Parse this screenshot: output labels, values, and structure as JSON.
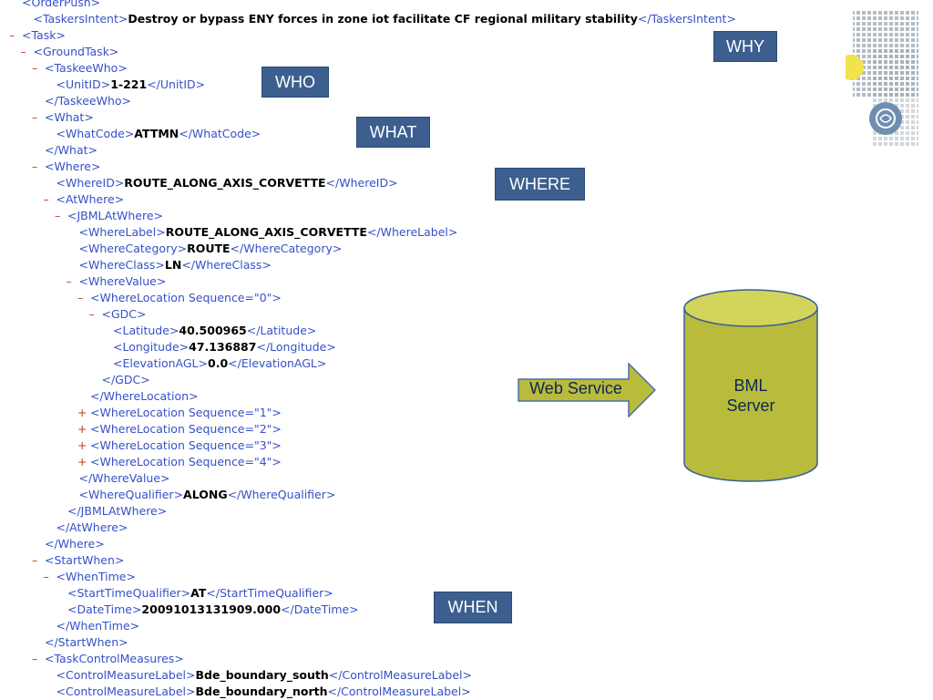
{
  "xml_lines": [
    {
      "pm": "",
      "indent": 0,
      "open": "<OrderPush>",
      "value": "",
      "close": ""
    },
    {
      "pm": "",
      "indent": 1,
      "open": "<TaskersIntent>",
      "value": "Destroy or bypass ENY forces in zone iot facilitate CF regional military stability",
      "close": "</TaskersIntent>"
    },
    {
      "pm": "–",
      "indent": 0,
      "open": "<Task>",
      "value": "",
      "close": ""
    },
    {
      "pm": "–",
      "indent": 1,
      "open": "<GroundTask>",
      "value": "",
      "close": ""
    },
    {
      "pm": "–",
      "indent": 2,
      "open": "<TaskeeWho>",
      "value": "",
      "close": ""
    },
    {
      "pm": "",
      "indent": 3,
      "open": "<UnitID>",
      "value": "1-221",
      "close": "</UnitID>"
    },
    {
      "pm": "",
      "indent": 2,
      "open": "</TaskeeWho>",
      "value": "",
      "close": ""
    },
    {
      "pm": "–",
      "indent": 2,
      "open": "<What>",
      "value": "",
      "close": ""
    },
    {
      "pm": "",
      "indent": 3,
      "open": "<WhatCode>",
      "value": "ATTMN",
      "close": "</WhatCode>"
    },
    {
      "pm": "",
      "indent": 2,
      "open": "</What>",
      "value": "",
      "close": ""
    },
    {
      "pm": "–",
      "indent": 2,
      "open": "<Where>",
      "value": "",
      "close": ""
    },
    {
      "pm": "",
      "indent": 3,
      "open": "<WhereID>",
      "value": "ROUTE_ALONG_AXIS_CORVETTE",
      "close": "</WhereID>"
    },
    {
      "pm": "–",
      "indent": 3,
      "open": "<AtWhere>",
      "value": "",
      "close": ""
    },
    {
      "pm": "–",
      "indent": 4,
      "open": "<JBMLAtWhere>",
      "value": "",
      "close": ""
    },
    {
      "pm": "",
      "indent": 5,
      "open": "<WhereLabel>",
      "value": "ROUTE_ALONG_AXIS_CORVETTE",
      "close": "</WhereLabel>"
    },
    {
      "pm": "",
      "indent": 5,
      "open": "<WhereCategory>",
      "value": "ROUTE",
      "close": "</WhereCategory>"
    },
    {
      "pm": "",
      "indent": 5,
      "open": "<WhereClass>",
      "value": "LN",
      "close": "</WhereClass>"
    },
    {
      "pm": "–",
      "indent": 5,
      "open": "<WhereValue>",
      "value": "",
      "close": ""
    },
    {
      "pm": "–",
      "indent": 6,
      "open": "<WhereLocation Sequence=\"0\">",
      "value": "",
      "close": ""
    },
    {
      "pm": "–",
      "indent": 7,
      "open": "<GDC>",
      "value": "",
      "close": ""
    },
    {
      "pm": "",
      "indent": 8,
      "open": "<Latitude>",
      "value": "40.500965",
      "close": "</Latitude>"
    },
    {
      "pm": "",
      "indent": 8,
      "open": "<Longitude>",
      "value": "47.136887",
      "close": "</Longitude>"
    },
    {
      "pm": "",
      "indent": 8,
      "open": "<ElevationAGL>",
      "value": "0.0",
      "close": "</ElevationAGL>"
    },
    {
      "pm": "",
      "indent": 7,
      "open": "</GDC>",
      "value": "",
      "close": ""
    },
    {
      "pm": "",
      "indent": 6,
      "open": "</WhereLocation>",
      "value": "",
      "close": ""
    },
    {
      "pm": "+",
      "indent": 6,
      "open": "<WhereLocation Sequence=\"1\">",
      "value": "",
      "close": ""
    },
    {
      "pm": "+",
      "indent": 6,
      "open": "<WhereLocation Sequence=\"2\">",
      "value": "",
      "close": ""
    },
    {
      "pm": "+",
      "indent": 6,
      "open": "<WhereLocation Sequence=\"3\">",
      "value": "",
      "close": ""
    },
    {
      "pm": "+",
      "indent": 6,
      "open": "<WhereLocation Sequence=\"4\">",
      "value": "",
      "close": ""
    },
    {
      "pm": "",
      "indent": 5,
      "open": "</WhereValue>",
      "value": "",
      "close": ""
    },
    {
      "pm": "",
      "indent": 5,
      "open": "<WhereQualifier>",
      "value": "ALONG",
      "close": "</WhereQualifier>"
    },
    {
      "pm": "",
      "indent": 4,
      "open": "</JBMLAtWhere>",
      "value": "",
      "close": ""
    },
    {
      "pm": "",
      "indent": 3,
      "open": "</AtWhere>",
      "value": "",
      "close": ""
    },
    {
      "pm": "",
      "indent": 2,
      "open": "</Where>",
      "value": "",
      "close": ""
    },
    {
      "pm": "–",
      "indent": 2,
      "open": "<StartWhen>",
      "value": "",
      "close": ""
    },
    {
      "pm": "–",
      "indent": 3,
      "open": "<WhenTime>",
      "value": "",
      "close": ""
    },
    {
      "pm": "",
      "indent": 4,
      "open": "<StartTimeQualifier>",
      "value": "AT",
      "close": "</StartTimeQualifier>"
    },
    {
      "pm": "",
      "indent": 4,
      "open": "<DateTime>",
      "value": "20091013131909.000",
      "close": "</DateTime>"
    },
    {
      "pm": "",
      "indent": 3,
      "open": "</WhenTime>",
      "value": "",
      "close": ""
    },
    {
      "pm": "",
      "indent": 2,
      "open": "</StartWhen>",
      "value": "",
      "close": ""
    },
    {
      "pm": "–",
      "indent": 2,
      "open": "<TaskControlMeasures>",
      "value": "",
      "close": ""
    },
    {
      "pm": "",
      "indent": 3,
      "open": "<ControlMeasureLabel>",
      "value": "Bde_boundary_south",
      "close": "</ControlMeasureLabel>"
    },
    {
      "pm": "",
      "indent": 3,
      "open": "<ControlMeasureLabel>",
      "value": "Bde_boundary_north",
      "close": "</ControlMeasureLabel>"
    }
  ],
  "labels": {
    "why": "WHY",
    "who": "WHO",
    "what": "WHAT",
    "where": "WHERE",
    "when": "WHEN"
  },
  "web_service": "Web Service",
  "server": {
    "line1": "BML",
    "line2": "Server"
  },
  "colors": {
    "tag": "#3550c8",
    "label_bg": "#3d5f8f",
    "arrow_fill": "#b9bb3c",
    "cylinder_fill": "#b9bb3c"
  }
}
